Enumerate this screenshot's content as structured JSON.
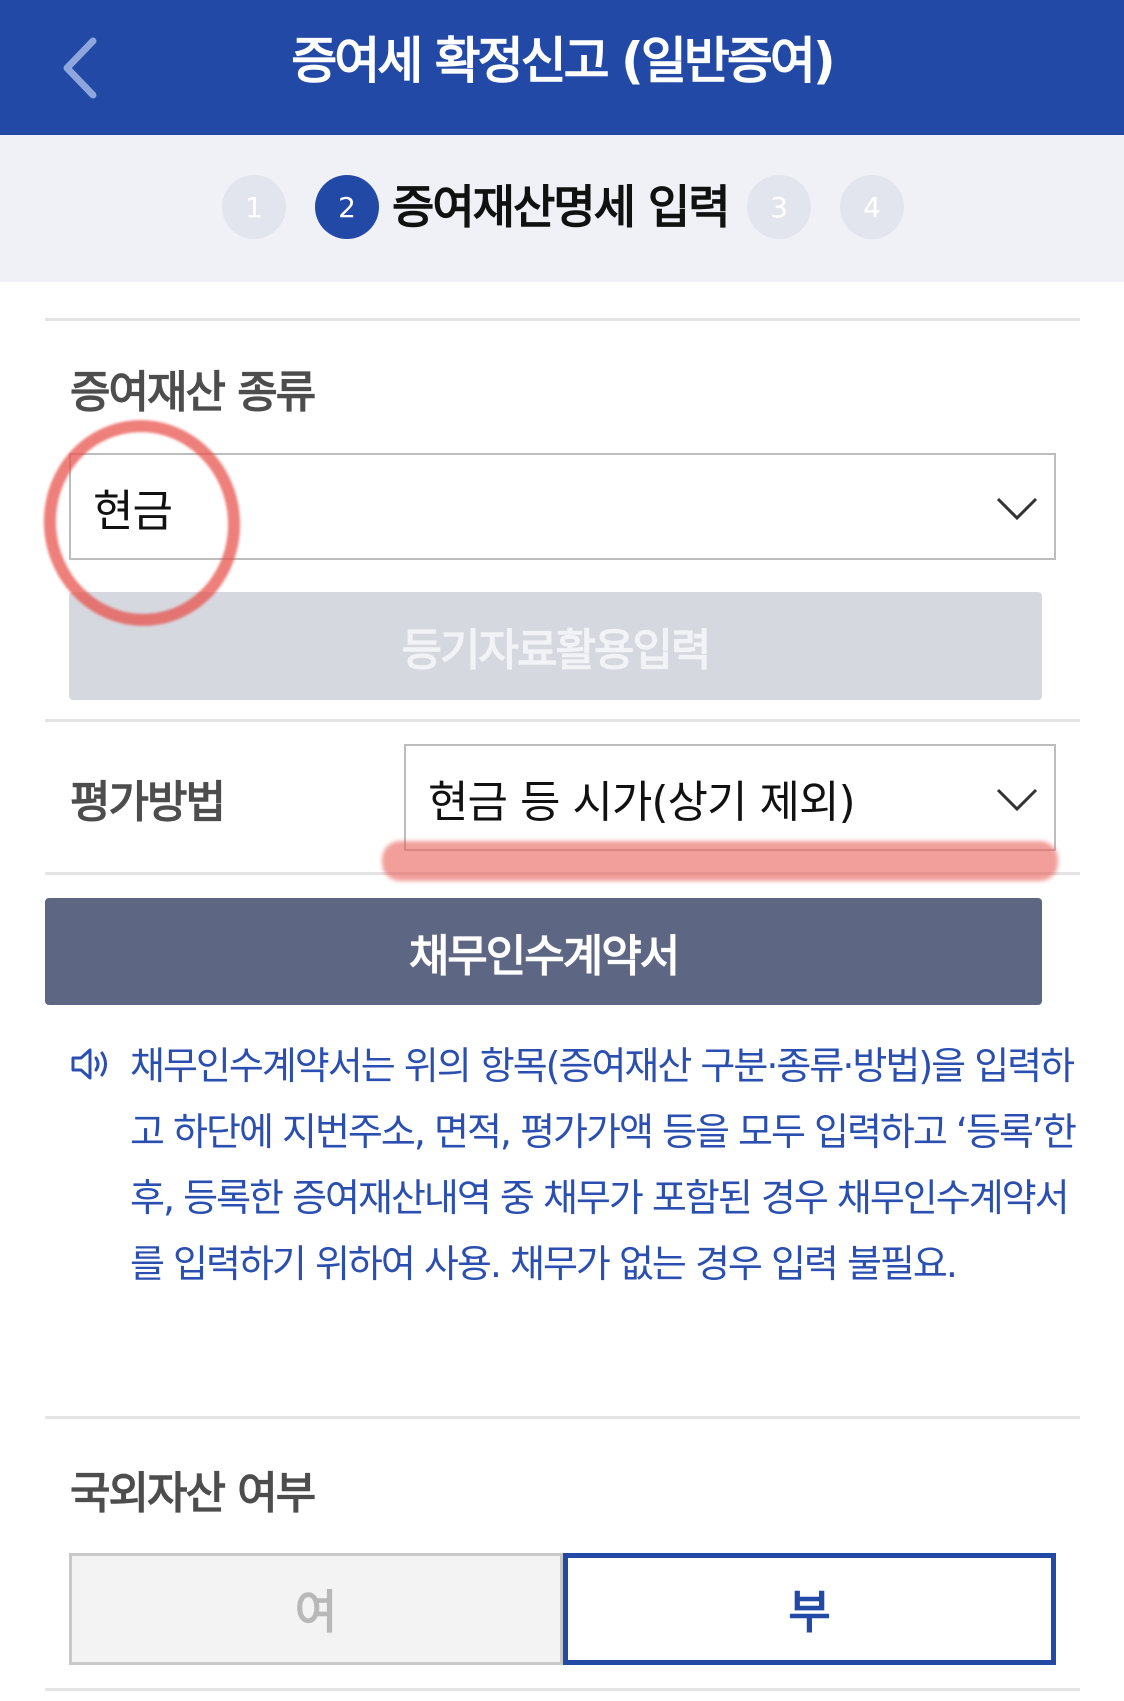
{
  "header": {
    "title": "증여세 확정신고 (일반증여)",
    "back_icon": "chevron-left-icon"
  },
  "steps": {
    "items": [
      "1",
      "2",
      "3",
      "4"
    ],
    "active": "2",
    "active_label": "증여재산명세 입력"
  },
  "asset_type": {
    "label": "증여재산 종류",
    "value": "현금",
    "registry_button": "등기자료활용입력"
  },
  "valuation": {
    "label": "평가방법",
    "value": "현금 등 시가(상기 제외)"
  },
  "debt_contract_button": "채무인수계약서",
  "notice": {
    "icon": "speaker-icon",
    "text": "채무인수계약서는 위의 항목(증여재산 구분·종류·방법)을 입력하고 하단에 지번주소, 면적, 평가가액 등을 모두 입력하고 ‘등록’한 후, 등록한 증여재산내역 중 채무가 포함된 경우 채무인수계약서를 입력하기 위하여 사용. 채무가 없는 경우 입력 불필요."
  },
  "foreign_asset": {
    "label": "국외자산 여부",
    "yes": "여",
    "no": "부",
    "selected": "부"
  },
  "colors": {
    "primary": "#2349a6",
    "dark_button": "#5d6683",
    "annotation_red": "#e84e46"
  }
}
